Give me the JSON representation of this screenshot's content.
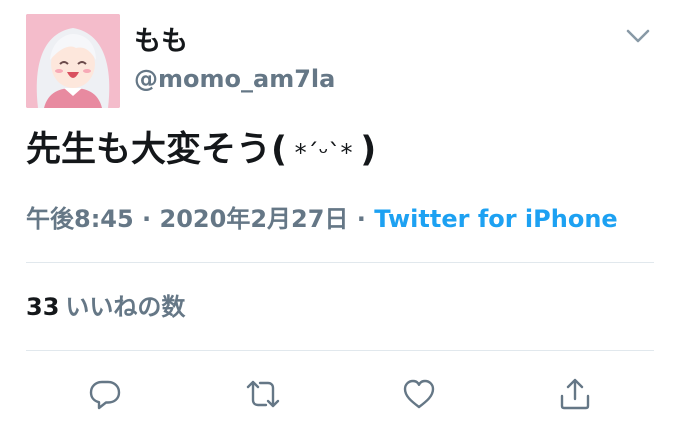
{
  "user": {
    "display_name": "もも",
    "handle": "@momo_am7la"
  },
  "tweet": {
    "text_main": "先生も大変そう(",
    "text_kaomoji": " *ˊᵕˋ* ",
    "text_end": ")"
  },
  "meta": {
    "time": "午後8:45",
    "separator1": " · ",
    "date": "2020年2月27日",
    "separator2": " · ",
    "source": "Twitter for iPhone"
  },
  "stats": {
    "likes_count": "33",
    "likes_label": "いいねの数"
  },
  "icons": {
    "menu": "chevron-down-icon",
    "reply": "reply-icon",
    "retweet": "retweet-icon",
    "like": "heart-icon",
    "share": "share-icon"
  },
  "colors": {
    "text": "#14171a",
    "secondary": "#657786",
    "link": "#1da1f2",
    "divider": "#e1e8ed",
    "avatar_bg": "#f2b6c4"
  }
}
